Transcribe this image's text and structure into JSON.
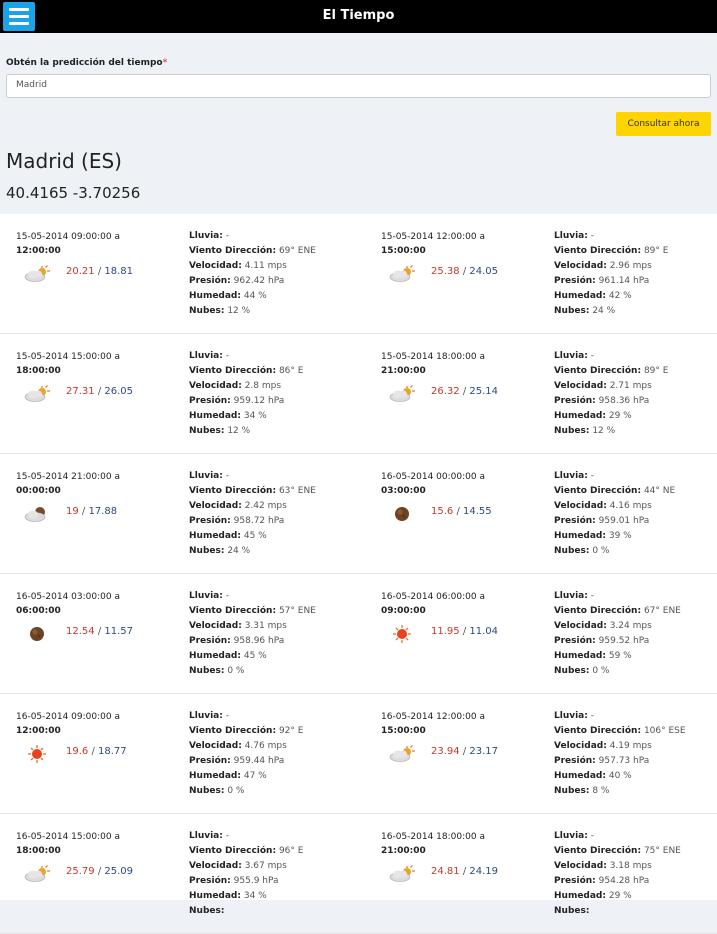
{
  "app": {
    "title": "El Tiempo"
  },
  "form": {
    "label": "Obtén la predicción del tiempo",
    "required_mark": "*",
    "input_value": "Madrid",
    "button_label": "Consultar ahora"
  },
  "location": {
    "city": "Madrid (ES)",
    "coords": "40.4165 -3.70256"
  },
  "labels": {
    "rain": "Lluvia:",
    "wind_dir": "Viento Dirección:",
    "speed": "Velocidad:",
    "pressure": "Presión:",
    "humidity": "Humedad:",
    "clouds": "Nubes:"
  },
  "forecasts": [
    {
      "start": "15-05-2014 09:00:00 a",
      "end": "12:00:00",
      "icon": "sun-cloud-icon",
      "max": "20.21",
      "min": "18.81",
      "rain": "-",
      "wind_dir": "69° ENE",
      "speed": "4.11 mps",
      "pressure": "962.42 hPa",
      "humidity": "44 %",
      "clouds": "12 %"
    },
    {
      "start": "15-05-2014 12:00:00 a",
      "end": "15:00:00",
      "icon": "sun-cloud-icon",
      "max": "25.38",
      "min": "24.05",
      "rain": "-",
      "wind_dir": "89° E",
      "speed": "2.96 mps",
      "pressure": "961.14 hPa",
      "humidity": "42 %",
      "clouds": "24 %"
    },
    {
      "start": "15-05-2014 15:00:00 a",
      "end": "18:00:00",
      "icon": "sun-cloud-icon",
      "max": "27.31",
      "min": "26.05",
      "rain": "-",
      "wind_dir": "86° E",
      "speed": "2.8 mps",
      "pressure": "959.12 hPa",
      "humidity": "34 %",
      "clouds": "12 %"
    },
    {
      "start": "15-05-2014 18:00:00 a",
      "end": "21:00:00",
      "icon": "sun-cloud-icon",
      "max": "26.32",
      "min": "25.14",
      "rain": "-",
      "wind_dir": "89° E",
      "speed": "2.71 mps",
      "pressure": "958.36 hPa",
      "humidity": "29 %",
      "clouds": "12 %"
    },
    {
      "start": "15-05-2014 21:00:00 a",
      "end": "00:00:00",
      "icon": "moon-cloud-icon",
      "max": "19",
      "min": "17.88",
      "rain": "-",
      "wind_dir": "63° ENE",
      "speed": "2.42 mps",
      "pressure": "958.72 hPa",
      "humidity": "45 %",
      "clouds": "24 %"
    },
    {
      "start": "16-05-2014 00:00:00 a",
      "end": "03:00:00",
      "icon": "moon-icon",
      "max": "15.6",
      "min": "14.55",
      "rain": "-",
      "wind_dir": "44° NE",
      "speed": "4.16 mps",
      "pressure": "959.01 hPa",
      "humidity": "39 %",
      "clouds": "0 %"
    },
    {
      "start": "16-05-2014 03:00:00 a",
      "end": "06:00:00",
      "icon": "moon-icon",
      "max": "12.54",
      "min": "11.57",
      "rain": "-",
      "wind_dir": "57° ENE",
      "speed": "3.31 mps",
      "pressure": "958.96 hPa",
      "humidity": "45 %",
      "clouds": "0 %"
    },
    {
      "start": "16-05-2014 06:00:00 a",
      "end": "09:00:00",
      "icon": "sun-icon",
      "max": "11.95",
      "min": "11.04",
      "rain": "-",
      "wind_dir": "67° ENE",
      "speed": "3.24 mps",
      "pressure": "959.52 hPa",
      "humidity": "59 %",
      "clouds": "0 %"
    },
    {
      "start": "16-05-2014 09:00:00 a",
      "end": "12:00:00",
      "icon": "sun-icon",
      "max": "19.6",
      "min": "18.77",
      "rain": "-",
      "wind_dir": "92° E",
      "speed": "4.76 mps",
      "pressure": "959.44 hPa",
      "humidity": "47 %",
      "clouds": "0 %"
    },
    {
      "start": "16-05-2014 12:00:00 a",
      "end": "15:00:00",
      "icon": "sun-cloud-icon",
      "max": "23.94",
      "min": "23.17",
      "rain": "-",
      "wind_dir": "106° ESE",
      "speed": "4.19 mps",
      "pressure": "957.73 hPa",
      "humidity": "40 %",
      "clouds": "8 %"
    },
    {
      "start": "16-05-2014 15:00:00 a",
      "end": "18:00:00",
      "icon": "sun-cloud-icon",
      "max": "25.79",
      "min": "25.09",
      "rain": "-",
      "wind_dir": "96° E",
      "speed": "3.67 mps",
      "pressure": "955.9 hPa",
      "humidity": "34 %",
      "clouds": ""
    },
    {
      "start": "16-05-2014 18:00:00 a",
      "end": "21:00:00",
      "icon": "sun-cloud-icon",
      "max": "24.81",
      "min": "24.19",
      "rain": "-",
      "wind_dir": "75° ENE",
      "speed": "3.18 mps",
      "pressure": "954.28 hPa",
      "humidity": "29 %",
      "clouds": ""
    }
  ]
}
